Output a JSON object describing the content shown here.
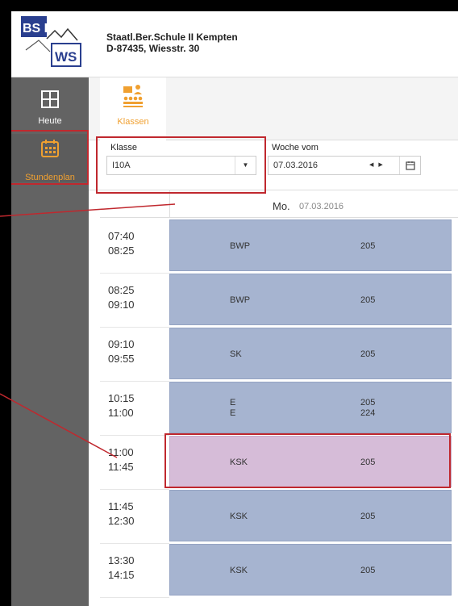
{
  "header": {
    "logo_text_top": "BS II",
    "logo_text_bottom": "WS",
    "school_name": "Staatl.Ber.Schule II Kempten",
    "school_address": "D-87435, Wiesstr. 30"
  },
  "sidebar": {
    "items": [
      {
        "label": "Heute",
        "icon": "grid-icon"
      },
      {
        "label": "Stundenplan",
        "icon": "calendar-icon"
      }
    ]
  },
  "tabs": [
    {
      "label": "Klassen",
      "icon": "class-icon"
    }
  ],
  "filters": {
    "class_label": "Klasse",
    "class_value": "I10A",
    "week_label": "Woche vom",
    "week_value": "07.03.2016"
  },
  "day": {
    "name": "Mo.",
    "date": "07.03.2016"
  },
  "lessons": [
    {
      "start": "07:40",
      "end": "08:25",
      "subjects": [
        "BWP"
      ],
      "rooms": [
        "205"
      ],
      "highlight": false
    },
    {
      "start": "08:25",
      "end": "09:10",
      "subjects": [
        "BWP"
      ],
      "rooms": [
        "205"
      ],
      "highlight": false
    },
    {
      "start": "09:10",
      "end": "09:55",
      "subjects": [
        "SK"
      ],
      "rooms": [
        "205"
      ],
      "highlight": false
    },
    {
      "start": "10:15",
      "end": "11:00",
      "subjects": [
        "E",
        "E"
      ],
      "rooms": [
        "205",
        "224"
      ],
      "highlight": false
    },
    {
      "start": "11:00",
      "end": "11:45",
      "subjects": [
        "KSK"
      ],
      "rooms": [
        "205"
      ],
      "highlight": true
    },
    {
      "start": "11:45",
      "end": "12:30",
      "subjects": [
        "KSK"
      ],
      "rooms": [
        "205"
      ],
      "highlight": false
    },
    {
      "start": "13:30",
      "end": "14:15",
      "subjects": [
        "KSK"
      ],
      "rooms": [
        "205"
      ],
      "highlight": false
    }
  ],
  "colors": {
    "accent": "#f0a030",
    "lesson": "#a6b4d0",
    "lesson_highlight": "#d6bcd8",
    "sidebar": "#636363",
    "annotation": "#c0282e"
  }
}
